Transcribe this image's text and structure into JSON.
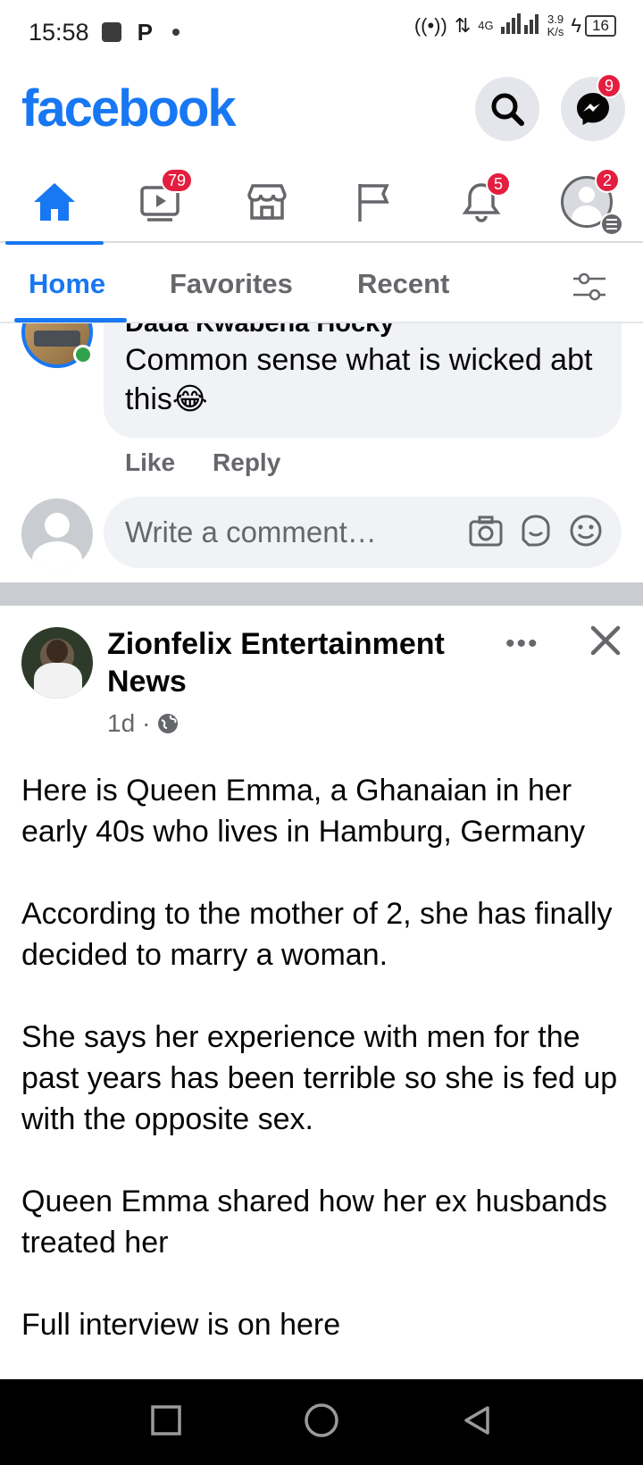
{
  "status_bar": {
    "time": "15:58",
    "p_label": "P",
    "network": "4G",
    "speed_value": "3.9",
    "speed_unit": "K/s",
    "battery": "16"
  },
  "header": {
    "logo": "facebook",
    "messenger_badge": "9"
  },
  "nav": {
    "watch_badge": "79",
    "notifications_badge": "5",
    "menu_badge": "2"
  },
  "feed_tabs": {
    "home": "Home",
    "favorites": "Favorites",
    "recent": "Recent"
  },
  "comment": {
    "author": "Dada Kwabena Hocky",
    "text": "Common sense what is wicked abt this😂",
    "like": "Like",
    "reply": "Reply"
  },
  "composer": {
    "placeholder": "Write a comment…"
  },
  "post": {
    "page_name": "Zionfelix Entertainment News",
    "time": "1d",
    "more": "•••",
    "paragraphs": [
      "Here is Queen Emma, a Ghanaian in her early 40s who lives in Hamburg, Germany",
      "According to the mother of 2, she has finally decided to marry a woman.",
      "She says her experience with men for the past years has been terrible so she is fed up with the opposite sex.",
      "Queen Emma shared how her ex husbands treated her",
      "Full interview is on here"
    ]
  },
  "colors": {
    "brand": "#1877f2",
    "badge": "#e41e3f",
    "muted": "#65676b",
    "bubble": "#f0f2f5"
  }
}
